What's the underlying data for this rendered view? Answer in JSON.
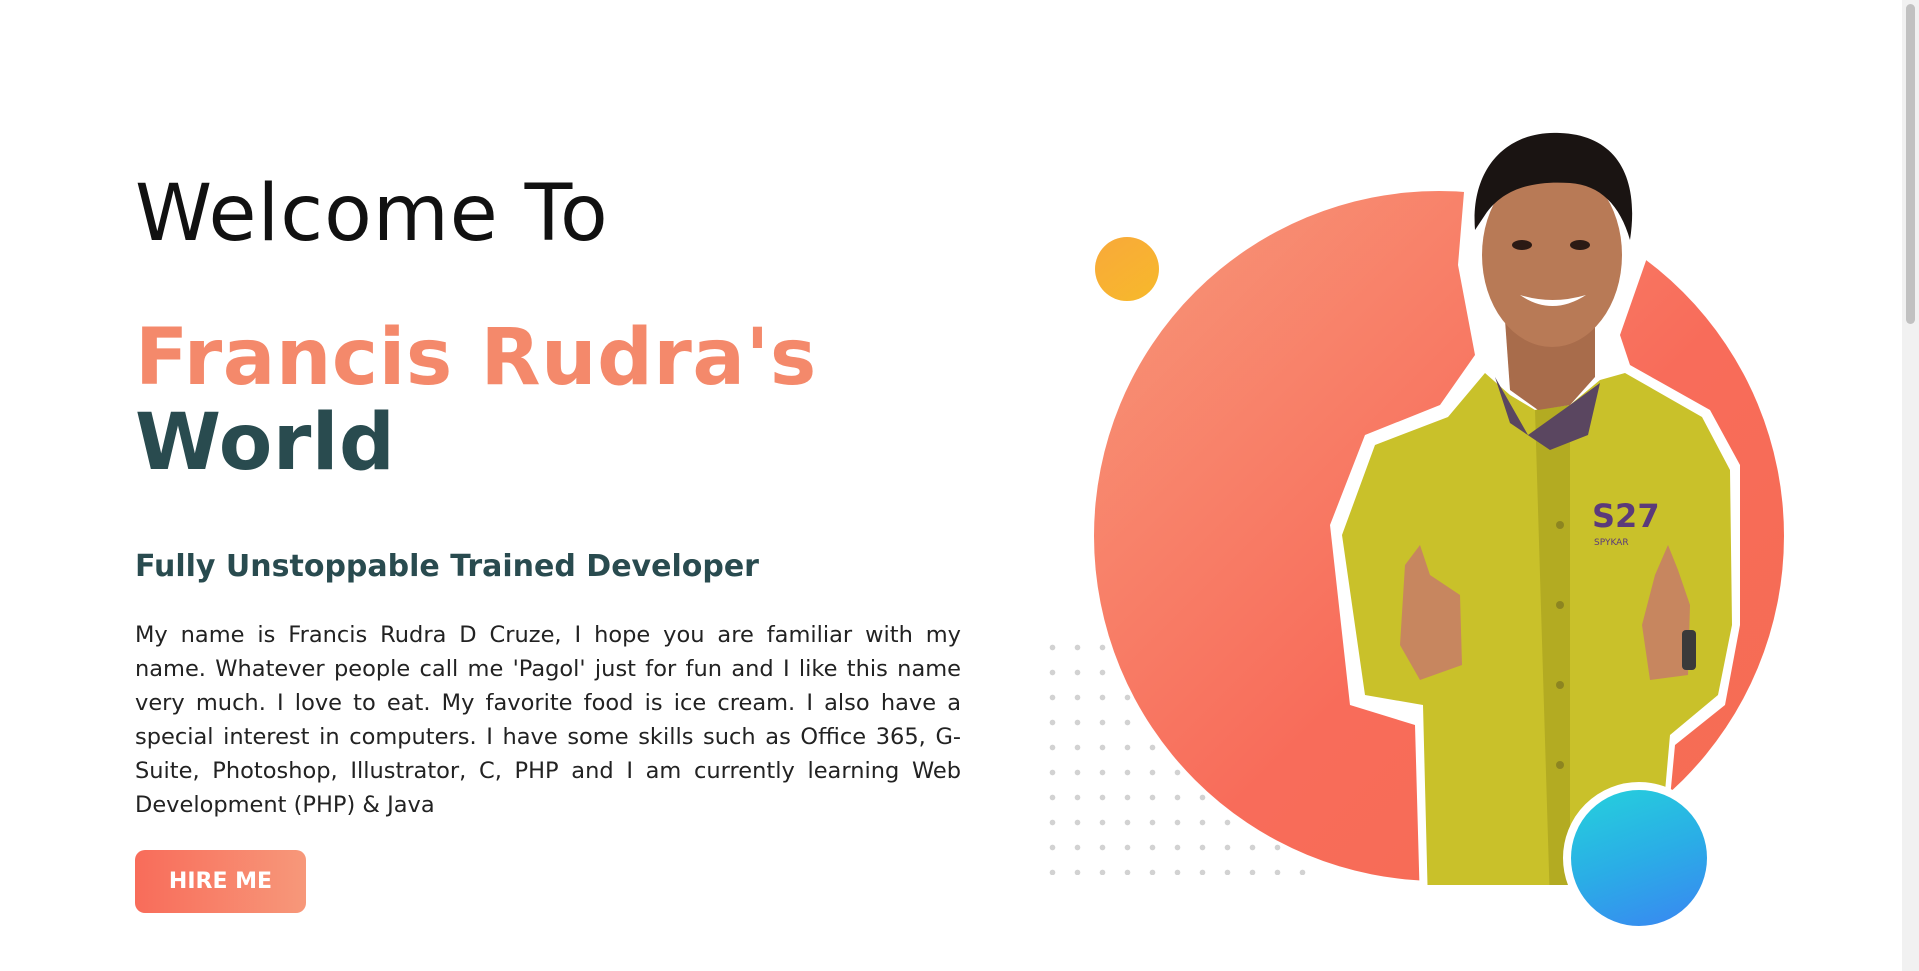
{
  "hero": {
    "welcome": "Welcome To",
    "name_accent": "Francis Rudra's",
    "name_dark": "World",
    "tagline": "Fully Unstoppable Trained Developer",
    "bio": "My name is Francis Rudra D Cruze, I hope you are familiar with my name. Whatever people call me 'Pagol' just for fun and I like this name very much. I love to eat. My favorite food is ice cream. I also have a special interest in computers. I have some skills such as Office 365, G-Suite, Photoshop, Illustrator, C, PHP and I am currently learning Web Development (PHP) & Java",
    "hire_button": "HIRE ME"
  },
  "portrait": {
    "shirt_print": "S27",
    "shirt_brand": "SPYKAR"
  },
  "colors": {
    "accent": "#f4896b",
    "dark": "#294b4f",
    "circle": "#f86c5a",
    "orange_dot": "#f8a93a",
    "teal_dot": "#2aaee6"
  }
}
